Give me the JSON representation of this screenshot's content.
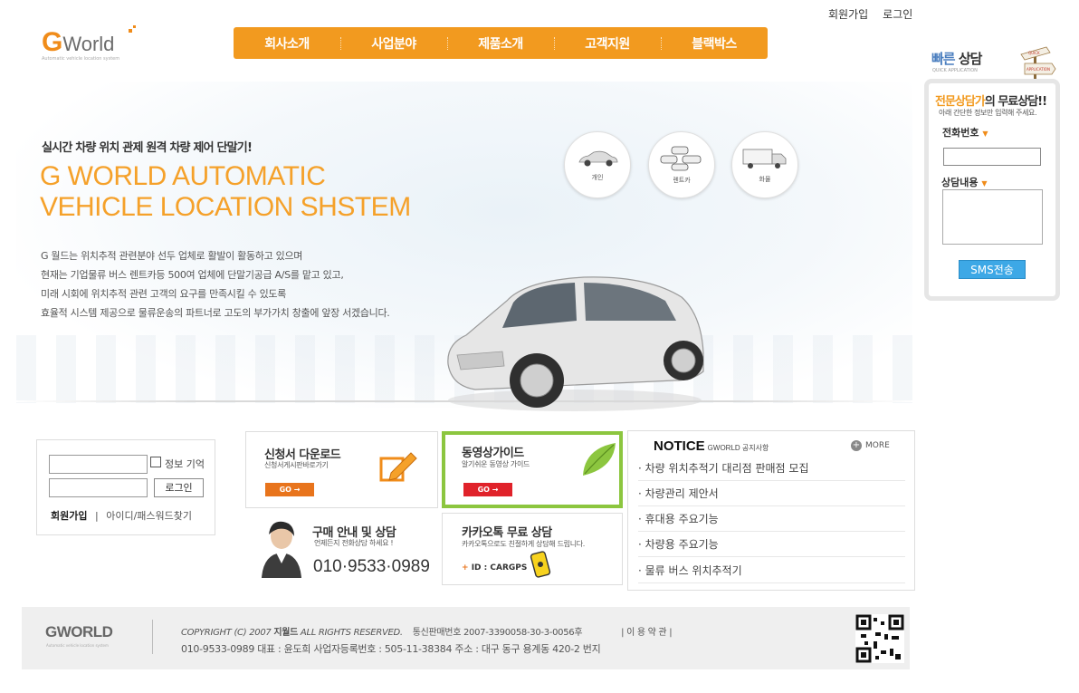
{
  "top_links": {
    "join": "회원가입",
    "login": "로그인"
  },
  "logo": {
    "g": "G",
    "word": "World",
    "sub": "Automatic vehicle location system"
  },
  "nav": [
    "회사소개",
    "사업분야",
    "제품소개",
    "고객지원",
    "블랙박스"
  ],
  "hero": {
    "tagline": "실시간 차량 위치 관제 원격 차량 제어 단말기!",
    "headline1": "G WORLD AUTOMATIC",
    "headline2": "VEHICLE LOCATION SHSTEM",
    "desc": [
      "G 월드는 위치추적 관련분야 선두 업체로 활발이 활동하고 있으며",
      "현재는 기업물류 버스 렌트카등 500여 업체에 단말기공급 A/S를 맡고 있고,",
      "미래 시회에 위치추적 관련 고객의 요구를 만족시킬 수 있도록",
      "효율적 시스템 제공으로 물류운송의 파트너로 고도의 부가가치 창출에 앞장 서겠습니다."
    ],
    "categories": [
      "개인",
      "렌트카",
      "화물"
    ]
  },
  "quick": {
    "title_a": "빠른",
    "title_b": "상담",
    "title_sub": "QUICK APPLICATION",
    "head_orange": "전문상담가",
    "head_dark1": "의 ",
    "head_dark2": "무료상담!!",
    "note": "아래 간단한 정보만 입력해 주세요.",
    "phone_label": "전화번호",
    "content_label": "상담내용",
    "star": "▼",
    "submit": "SMS전송",
    "sign_top": "QUICK",
    "sign_bottom": "APPLICATION"
  },
  "login": {
    "remember": "정보 기억",
    "button": "로그인",
    "join": "회원가입",
    "sep": "|",
    "find": "아이디/패스워드찾기"
  },
  "download": {
    "title": "신청서 다운로드",
    "sub": "신청서게시판바로가기",
    "go": "GO →"
  },
  "video": {
    "title": "동영상가이드",
    "sub": "알기쉬운 동영상 가이드",
    "go": "GO →"
  },
  "purchase": {
    "title": "구매 안내 및 상담",
    "sub": "언제든지 전화상담 하세요 !",
    "phone": "010·9533·0989"
  },
  "kakao": {
    "title": "카카오톡 무료 상담",
    "sub": "카카오톡으로도 친절하게 상담해 드립니다.",
    "plus": "+",
    "id": "ID : CARGPS"
  },
  "notice": {
    "title": "NOTICE",
    "title_sub": "GWORLD 공지사항",
    "more": "MORE",
    "more_icon": "+",
    "items": [
      "· 차량 위치추적기 대리점 판매점 모집",
      "· 차량관리 제안서",
      "· 휴대용 주요기능",
      "· 차량용 주요기능",
      "· 물류 버스 위치추적기"
    ]
  },
  "footer": {
    "logo": "GWORLD",
    "logo_sub": "Automatic vehicle location system",
    "copyright_a": "COPYRIGHT (C) 2007 ",
    "copyright_b": "지월드",
    "copyright_c": " ALL RIGHTS RESERVED.",
    "telecom": "통신판매번호 2007-3390058-30-3-0056후",
    "terms": "|  이 용 약 관  |",
    "line2": "010-9533-0989   대표 : 윤도희    사업자등록번호 : 505-11-38384    주소 : 대구 동구 용계동 420-2 번지"
  },
  "colors": {
    "accent": "#f29a1f",
    "blue": "#3da8e6",
    "green_border": "#8cc63f"
  }
}
